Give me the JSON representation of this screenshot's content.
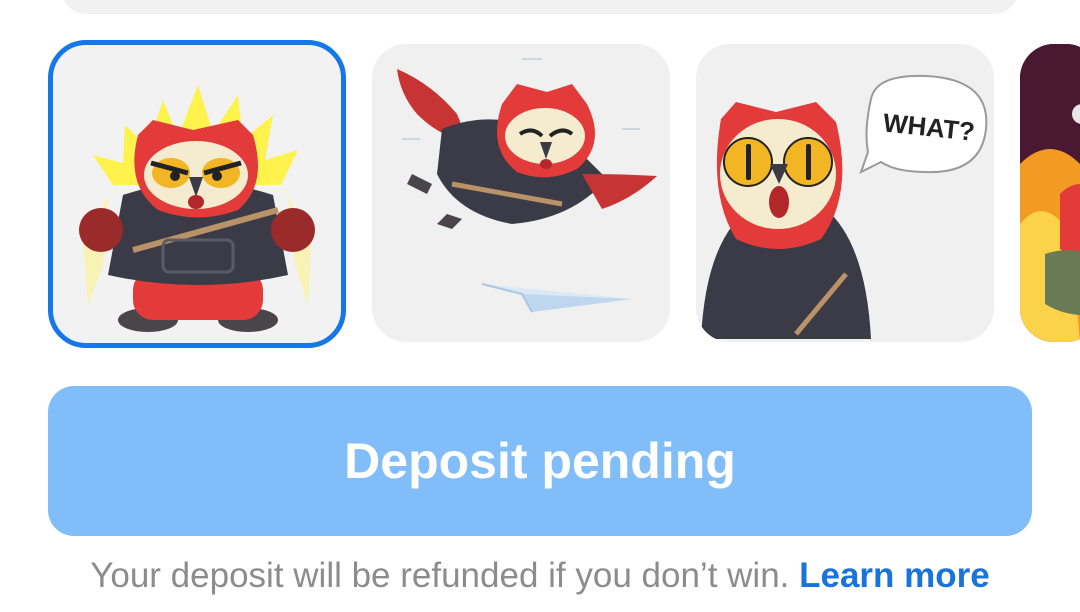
{
  "stickers": [
    {
      "name": "owl-powered-up",
      "selected": true
    },
    {
      "name": "owl-flying-paper-plane",
      "selected": false
    },
    {
      "name": "owl-what-speech",
      "selected": false,
      "speech_text": "WHAT?"
    },
    {
      "name": "owl-fire-partial",
      "selected": false
    }
  ],
  "action": {
    "button_label": "Deposit pending"
  },
  "footer": {
    "notice": "Your deposit will be refunded if you don’t win.",
    "link_label": "Learn more"
  },
  "colors": {
    "accent": "#1677e8",
    "button_bg": "#80bdf9",
    "owl_red": "#e23b3a",
    "cloak": "#3a3b46"
  }
}
